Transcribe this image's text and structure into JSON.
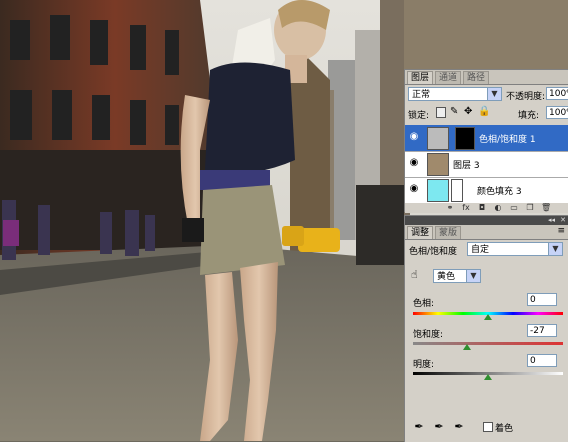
{
  "layers_panel": {
    "tabs": [
      "图层",
      "通道",
      "路径"
    ],
    "blend_mode": "正常",
    "opacity_label": "不透明度:",
    "opacity_value": "100%",
    "lock_label": "锁定:",
    "fill_label": "填充:",
    "fill_value": "100%",
    "layers": [
      {
        "name": "色相/饱和度 1",
        "selected": true
      },
      {
        "name": "图层 3",
        "selected": false
      },
      {
        "name": "颜色填充 3",
        "selected": false
      }
    ],
    "footer_icons": [
      "link-icon",
      "fx-icon",
      "mask-icon",
      "adjustment-icon",
      "folder-icon",
      "new-layer-icon",
      "trash-icon"
    ]
  },
  "adjust_panel": {
    "tabs": [
      "调整",
      "蒙版"
    ],
    "title": "色相/饱和度",
    "preset": "自定",
    "channel": "黄色",
    "hue_label": "色相:",
    "hue_value": "0",
    "sat_label": "饱和度:",
    "sat_value": "-27",
    "light_label": "明度:",
    "light_value": "0",
    "colorize_label": "着色",
    "colorize_checked": false,
    "hue_level": 0.5,
    "sat_level": 0.36,
    "light_level": 0.5
  },
  "colors": {
    "panel_bg": "#d4d0c8",
    "selection": "#316ac5",
    "fill_swatch": "#7de8f0"
  }
}
